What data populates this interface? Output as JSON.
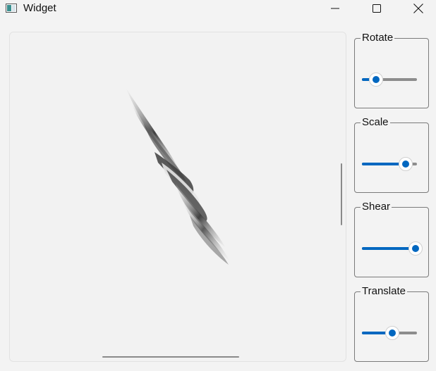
{
  "window": {
    "title": "Widget",
    "icon": "app-window-icon",
    "controls": [
      "minimize-icon",
      "maximize-icon",
      "close-icon"
    ]
  },
  "view": {
    "image": "twisted-swirl-graphic"
  },
  "accent_color": "#0067c0",
  "groups": [
    {
      "key": "rotate",
      "label": "Rotate",
      "value_fraction": 0.25
    },
    {
      "key": "scale",
      "label": "Scale",
      "value_fraction": 0.8
    },
    {
      "key": "shear",
      "label": "Shear",
      "value_fraction": 0.97
    },
    {
      "key": "translate",
      "label": "Translate",
      "value_fraction": 0.55
    }
  ]
}
